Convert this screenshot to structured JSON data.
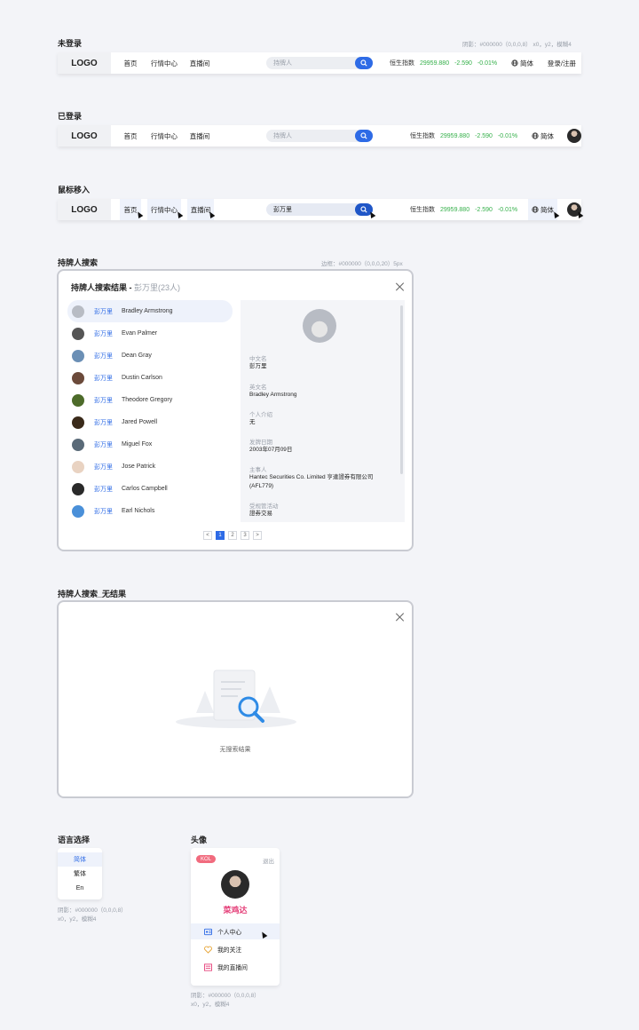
{
  "sections": {
    "logged_out": "未登录",
    "logged_in": "已登录",
    "hover": "鼠标移入",
    "search": "持牌人搜索",
    "search_empty": "持牌人搜索_无结果",
    "lang": "语言选择",
    "avatar": "头像"
  },
  "notes": {
    "bar_shadow": "阴影：#000000（0,0,0,8） x0，y2，模糊4",
    "modal_border": "边框：#000000（0,0,0,20）5px",
    "lang_shadow_1": "阴影：#000000（0,0,0,8）",
    "lang_shadow_2": "x0，y2，模糊4",
    "avatar_shadow_1": "阴影：#000000（0,0,0,8）",
    "avatar_shadow_2": "x0，y2，模糊4"
  },
  "header": {
    "logo": "LOGO",
    "nav": [
      "首页",
      "行情中心",
      "直播间"
    ],
    "search_placeholder": "持牌人",
    "search_value": "彭万里",
    "quote_name": "恒生指数",
    "quote_value": "29959.880",
    "quote_change": "-2.590",
    "quote_pct": "-0.01%",
    "lang": "简体",
    "login": "登录/注册"
  },
  "search_modal": {
    "title": "持牌人搜索结果 - ",
    "query": "彭万里(23人)",
    "results": [
      {
        "cn": "彭万里",
        "en": "Bradley Armstrong",
        "color": "#b8bcc4"
      },
      {
        "cn": "彭万里",
        "en": "Evan Palmer",
        "color": "#555555"
      },
      {
        "cn": "彭万里",
        "en": "Dean Gray",
        "color": "#6b8fb5"
      },
      {
        "cn": "彭万里",
        "en": "Dustin Carlson",
        "color": "#6b4a3a"
      },
      {
        "cn": "彭万里",
        "en": "Theodore Gregory",
        "color": "#4d6b2a"
      },
      {
        "cn": "彭万里",
        "en": "Jared Powell",
        "color": "#3a2a1a"
      },
      {
        "cn": "彭万里",
        "en": "Miguel Fox",
        "color": "#5a6a78"
      },
      {
        "cn": "彭万里",
        "en": "Jose Patrick",
        "color": "#e9d3c2"
      },
      {
        "cn": "彭万里",
        "en": "Carlos Campbell",
        "color": "#2a2a2a"
      },
      {
        "cn": "彭万里",
        "en": "Earl Nichols",
        "color": "#4a90d9"
      }
    ],
    "detail": {
      "cn_label": "中文名",
      "cn": "彭万里",
      "en_label": "英文名",
      "en": "Bradley Armstrong",
      "intro_label": "个人介绍",
      "intro": "无",
      "date_label": "发牌日期",
      "date": "2003年07月09日",
      "firm_label": "主事人",
      "firm": "Hantec Securities Co. Limited 亨達證券有限公司 (AFL779)",
      "activity_label": "受规管活动",
      "activity": "證券交易"
    },
    "pages": [
      "<",
      "1",
      "2",
      "3",
      ">"
    ]
  },
  "empty": {
    "text": "无搜索结果"
  },
  "lang_menu": [
    "简体",
    "繁体",
    "En"
  ],
  "user_menu": {
    "badge": "KOL",
    "logout": "退出",
    "name": "菜鸡达",
    "items": [
      "个人中心",
      "我的关注",
      "我的直播间"
    ]
  },
  "colors": {
    "accent": "#2e6be6",
    "up": "#35b04a",
    "pink": "#e5417a"
  }
}
